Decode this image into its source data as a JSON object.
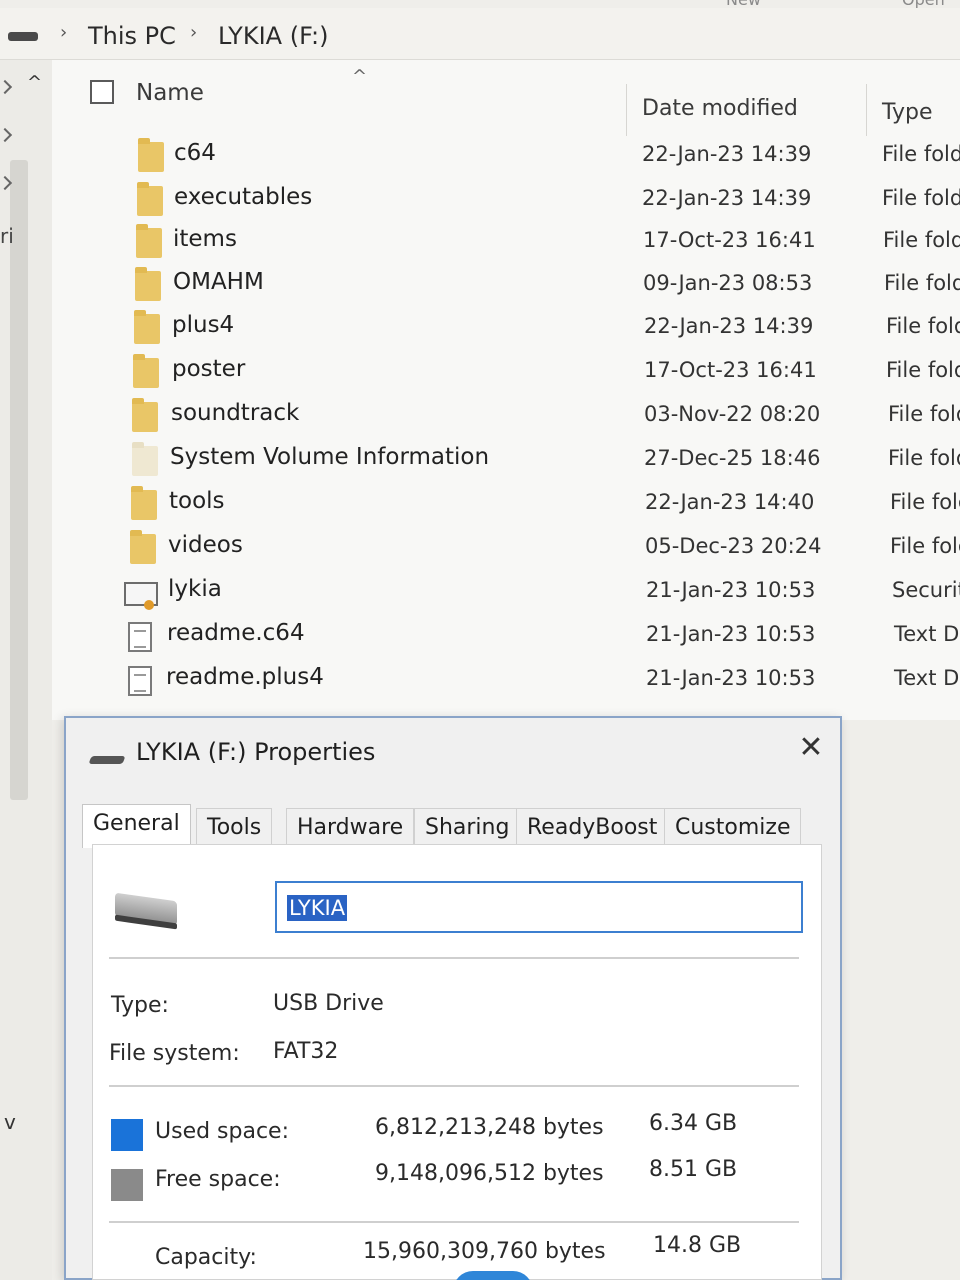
{
  "top_strip": {
    "new_label": "New",
    "open_label": "Open"
  },
  "addressbar": {
    "chevron": "›",
    "crumbs": [
      "This PC",
      "LYKIA (F:)"
    ]
  },
  "navpane": {
    "frag_1": "ri"
  },
  "columns": {
    "name": "Name",
    "date_modified": "Date modified",
    "type": "Type"
  },
  "files": [
    {
      "name": "c64",
      "date": "22-Jan-23 14:39",
      "type": "File folder",
      "icon": "folder-icon"
    },
    {
      "name": "executables",
      "date": "22-Jan-23 14:39",
      "type": "File folder",
      "icon": "folder-icon"
    },
    {
      "name": "items",
      "date": "17-Oct-23 16:41",
      "type": "File folder",
      "icon": "folder-icon"
    },
    {
      "name": "OMAHM",
      "date": "09-Jan-23 08:53",
      "type": "File folder",
      "icon": "folder-icon"
    },
    {
      "name": "plus4",
      "date": "22-Jan-23 14:39",
      "type": "File folder",
      "icon": "folder-icon"
    },
    {
      "name": "poster",
      "date": "17-Oct-23 16:41",
      "type": "File folder",
      "icon": "folder-icon"
    },
    {
      "name": "soundtrack",
      "date": "03-Nov-22 08:20",
      "type": "File folder",
      "icon": "folder-icon"
    },
    {
      "name": "System Volume Information",
      "date": "27-Dec-25 18:46",
      "type": "File folder",
      "icon": "system-folder-icon"
    },
    {
      "name": "tools",
      "date": "22-Jan-23 14:40",
      "type": "File folder",
      "icon": "folder-icon"
    },
    {
      "name": "videos",
      "date": "05-Dec-23 20:24",
      "type": "File folder",
      "icon": "folder-icon"
    },
    {
      "name": "lykia",
      "date": "21-Jan-23 10:53",
      "type": "Security",
      "icon": "certificate-icon"
    },
    {
      "name": "readme.c64",
      "date": "21-Jan-23 10:53",
      "type": "Text D",
      "icon": "text-file-icon"
    },
    {
      "name": "readme.plus4",
      "date": "21-Jan-23 10:53",
      "type": "Text D",
      "icon": "text-file-icon"
    }
  ],
  "dialog": {
    "title": "LYKIA (F:) Properties",
    "close_glyph": "✕",
    "tabs": [
      "General",
      "Tools",
      "Hardware",
      "Sharing",
      "ReadyBoost",
      "Customize"
    ],
    "active_tab": "General",
    "volume_label": "LYKIA",
    "type_label": "Type:",
    "type_value": "USB Drive",
    "fs_label": "File system:",
    "fs_value": "FAT32",
    "used_label": "Used space:",
    "used_bytes": "6,812,213,248 bytes",
    "used_human": "6.34 GB",
    "free_label": "Free space:",
    "free_bytes": "9,148,096,512 bytes",
    "free_human": "8.51 GB",
    "capacity_label": "Capacity:",
    "capacity_bytes": "15,960,309,760 bytes",
    "capacity_human": "14.8 GB",
    "colors": {
      "used": "#1a73d9",
      "free": "#8a8a8a"
    }
  }
}
